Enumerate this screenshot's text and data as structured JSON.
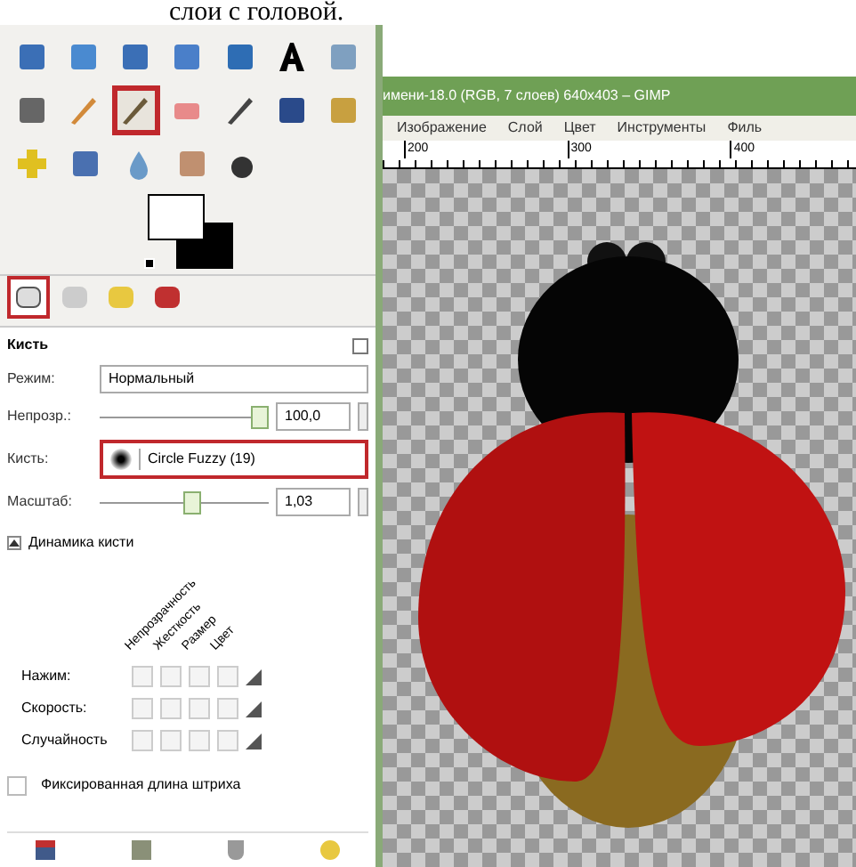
{
  "page_text": "слои с головой.",
  "toolbox": {
    "tools": [
      {
        "kind": "move",
        "selected": false
      },
      {
        "kind": "align",
        "selected": false
      },
      {
        "kind": "perspective",
        "selected": false
      },
      {
        "kind": "shear",
        "selected": false
      },
      {
        "kind": "flip",
        "selected": false
      },
      {
        "kind": "text",
        "selected": false
      },
      {
        "kind": "bucket",
        "selected": false
      },
      {
        "kind": "gradient",
        "selected": false
      },
      {
        "kind": "pencil",
        "selected": false
      },
      {
        "kind": "brush",
        "selected": true
      },
      {
        "kind": "eraser",
        "selected": false
      },
      {
        "kind": "airbrush",
        "selected": false
      },
      {
        "kind": "ink",
        "selected": false
      },
      {
        "kind": "clone",
        "selected": false
      },
      {
        "kind": "heal",
        "selected": false
      },
      {
        "kind": "stamp",
        "selected": false
      },
      {
        "kind": "blur",
        "selected": false
      },
      {
        "kind": "smudge",
        "selected": false
      },
      {
        "kind": "dodge",
        "selected": false
      }
    ]
  },
  "dock_tabs": [
    {
      "kind": "options",
      "selected": true
    },
    {
      "kind": "devices",
      "selected": false
    },
    {
      "kind": "undo",
      "selected": false
    },
    {
      "kind": "layers",
      "selected": false
    }
  ],
  "tool_options": {
    "title": "Кисть",
    "mode": {
      "label": "Режим:",
      "value": "Нормальный"
    },
    "opacity": {
      "label": "Непрозр.:",
      "level": 0.95,
      "value": "100,0"
    },
    "brush": {
      "label": "Кисть:",
      "value": "Circle Fuzzy (19)"
    },
    "scale": {
      "label": "Масштаб:",
      "level": 0.55,
      "value": "1,03"
    },
    "dynamics": {
      "title": "Динамика кисти",
      "expanded": true,
      "columns": [
        "Непрозрачность",
        "Жесткость",
        "Размер",
        "Цвет"
      ],
      "rows": [
        {
          "label": "Нажим:",
          "checks": [
            false,
            false,
            false,
            false
          ]
        },
        {
          "label": "Скорость:",
          "checks": [
            false,
            false,
            false,
            false
          ]
        },
        {
          "label": "Случайность",
          "checks": [
            false,
            false,
            false,
            false
          ]
        }
      ]
    },
    "fixed_length": {
      "label": "Фиксированная длина штриха",
      "checked": false
    }
  },
  "image_window": {
    "title": "имени-18.0 (RGB, 7 слоев) 640x403 – GIMP",
    "menu": [
      "Изображение",
      "Слой",
      "Цвет",
      "Инструменты",
      "Филь"
    ],
    "ruler": [
      "200",
      "300",
      "400"
    ]
  }
}
